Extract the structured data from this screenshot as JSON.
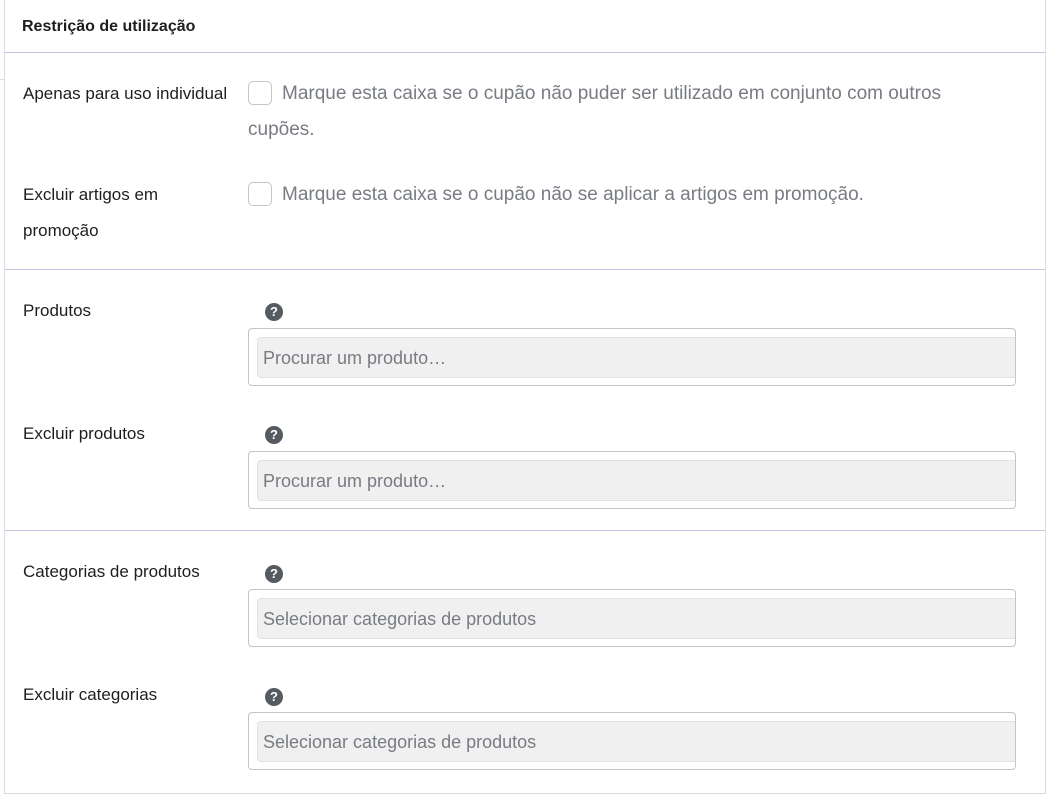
{
  "panel": {
    "title": "Restrição de utilização"
  },
  "individual_use": {
    "label": "Apenas para uso individual",
    "checked": false,
    "description_line1": "Marque esta caixa se o cupão não puder ser utilizado em conjunto com outros",
    "description_line2": "cupões."
  },
  "exclude_sale": {
    "label_line1": "Excluir artigos em",
    "label_line2": "promoção",
    "checked": false,
    "description": "Marque esta caixa se o cupão não se aplicar a artigos em promoção."
  },
  "products": {
    "label": "Produtos",
    "help_icon": "question-circle-icon",
    "placeholder": "Procurar um produto…"
  },
  "exclude_products": {
    "label": "Excluir produtos",
    "help_icon": "question-circle-icon",
    "placeholder": "Procurar um produto…"
  },
  "product_categories": {
    "label": "Categorias de produtos",
    "help_icon": "question-circle-icon",
    "placeholder": "Selecionar categorias de produtos"
  },
  "exclude_categories": {
    "label": "Excluir categorias",
    "help_icon": "question-circle-icon",
    "placeholder": "Selecionar categorias de produtos"
  },
  "colors": {
    "divider": "#c9c5e3",
    "help_icon_bg": "#555b61",
    "select_fill": "#f0f0f1",
    "muted_text": "#787c82"
  }
}
